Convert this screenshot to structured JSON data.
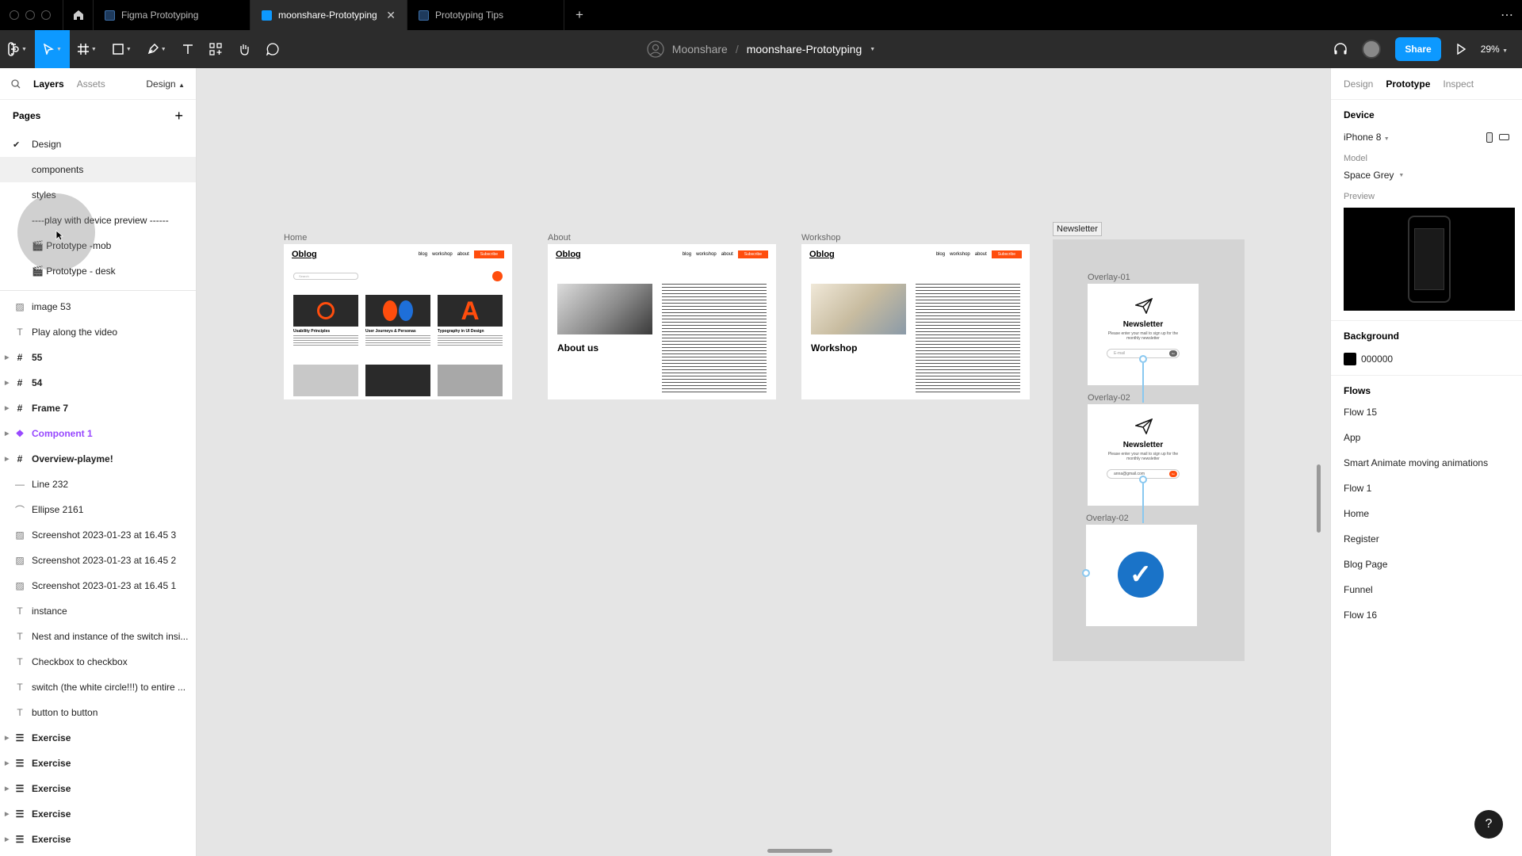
{
  "tabs": [
    {
      "label": "Figma Prototyping",
      "active": false
    },
    {
      "label": "moonshare-Prototyping",
      "active": true
    },
    {
      "label": "Prototyping Tips",
      "active": false
    }
  ],
  "toolbar": {
    "project": "Moonshare",
    "separator": "/",
    "file_name": "moonshare-Prototyping",
    "share_label": "Share",
    "zoom": "29%"
  },
  "left_panel": {
    "tab_layers": "Layers",
    "tab_assets": "Assets",
    "page_selector": "Design",
    "pages_title": "Pages",
    "pages": [
      {
        "label": "Design",
        "current": true
      },
      {
        "label": "components",
        "current": false
      },
      {
        "label": "styles",
        "current": false
      },
      {
        "label": "----play with device preview ------",
        "current": false
      },
      {
        "label": "🎬 Prototype -mob",
        "current": false
      },
      {
        "label": "🎬 Prototype - desk",
        "current": false
      }
    ],
    "layers": [
      {
        "label": "image 53",
        "type": "image"
      },
      {
        "label": "Play along the video",
        "type": "text"
      },
      {
        "label": "55",
        "type": "frame"
      },
      {
        "label": "54",
        "type": "frame"
      },
      {
        "label": "Frame 7",
        "type": "frame"
      },
      {
        "label": "Component 1",
        "type": "component"
      },
      {
        "label": "Overview-playme!",
        "type": "frame"
      },
      {
        "label": "Line 232",
        "type": "line"
      },
      {
        "label": "Ellipse 2161",
        "type": "ellipse"
      },
      {
        "label": "Screenshot 2023-01-23 at 16.45 3",
        "type": "image"
      },
      {
        "label": "Screenshot 2023-01-23 at 16.45 2",
        "type": "image"
      },
      {
        "label": "Screenshot 2023-01-23 at 16.45 1",
        "type": "image"
      },
      {
        "label": "instance",
        "type": "text"
      },
      {
        "label": "Nest and instance of the switch insi...",
        "type": "text"
      },
      {
        "label": "Checkbox to checkbox",
        "type": "text"
      },
      {
        "label": "switch (the white circle!!!) to entire ...",
        "type": "text"
      },
      {
        "label": "button to button",
        "type": "text"
      },
      {
        "label": "Exercise",
        "type": "section"
      },
      {
        "label": "Exercise",
        "type": "section"
      },
      {
        "label": "Exercise",
        "type": "section"
      },
      {
        "label": "Exercise",
        "type": "section"
      },
      {
        "label": "Exercise",
        "type": "section"
      }
    ]
  },
  "canvas": {
    "frames": {
      "home": {
        "label": "Home",
        "logo": "Oblog",
        "search": "Search",
        "cards": [
          "Usability Principles",
          "User Journeys & Personas",
          "Typography in UI Design"
        ]
      },
      "about": {
        "label": "About",
        "logo": "Oblog",
        "heading": "About us"
      },
      "workshop": {
        "label": "Workshop",
        "logo": "Oblog",
        "heading": "Workshop"
      }
    },
    "site_nav": [
      "blog",
      "workshop",
      "about"
    ],
    "subscribe": "Subscribe",
    "newsletter": {
      "label": "Newsletter",
      "overlays": [
        "Overlay-01",
        "Overlay-02",
        "Overlay-02"
      ],
      "title": "Newsletter",
      "desc": "Please enter your mail to sign up for the monthly newsletter",
      "input_placeholder": "E-mail",
      "input_value": "anna@gmail.com",
      "go_label": "Go"
    }
  },
  "right_panel": {
    "tabs": [
      "Design",
      "Prototype",
      "Inspect"
    ],
    "device_title": "Device",
    "device": "iPhone 8",
    "model_label": "Model",
    "model": "Space Grey",
    "preview_label": "Preview",
    "background_title": "Background",
    "background_value": "000000",
    "flows_title": "Flows",
    "flows": [
      "Flow 15",
      "App",
      "Smart Animate moving animations",
      "Flow 1",
      "Home",
      "Register",
      "Blog Page",
      "Funnel",
      "Flow 16"
    ]
  },
  "colors": {
    "accent": "#0d99ff",
    "brand_orange": "#ff4d0d",
    "component": "#9747ff"
  }
}
